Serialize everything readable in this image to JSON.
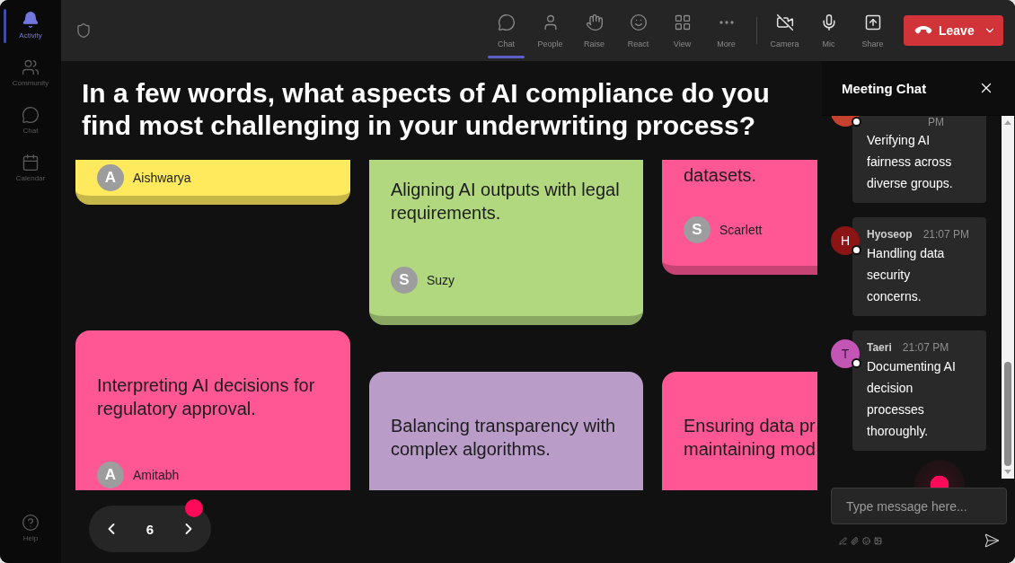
{
  "rail": {
    "items": [
      {
        "kind": "activity",
        "label": "Activity",
        "selected": true
      },
      {
        "kind": "community",
        "label": "Community",
        "selected": false
      },
      {
        "kind": "chat",
        "label": "Chat",
        "selected": false
      },
      {
        "kind": "calendar",
        "label": "Calendar",
        "selected": false
      }
    ],
    "help": "Help"
  },
  "toolbar": {
    "items": [
      {
        "kind": "chat",
        "label": "Chat",
        "selected": true
      },
      {
        "kind": "people",
        "label": "People",
        "selected": false
      },
      {
        "kind": "raise",
        "label": "Raise",
        "selected": false
      },
      {
        "kind": "react",
        "label": "React",
        "selected": false
      },
      {
        "kind": "view",
        "label": "View",
        "selected": false
      },
      {
        "kind": "more",
        "label": "More",
        "selected": false
      }
    ],
    "devices": [
      {
        "kind": "camera",
        "label": "Camera"
      },
      {
        "kind": "mic",
        "label": "Mic"
      },
      {
        "kind": "share",
        "label": "Share"
      }
    ],
    "leave": "Leave"
  },
  "question": "In a few words, what aspects of AI compliance do you find most challenging in your underwriting process?",
  "board": {
    "columns": [
      {
        "cards": [
          {
            "color": "#ffe95c",
            "author": "Aishwarya",
            "initial": "A"
          },
          {
            "color": "#ff5694",
            "text": "Interpreting AI decisions for regulatory approval.",
            "author": "Amitabh",
            "initial": "A"
          }
        ]
      },
      {
        "cards": [
          {
            "color": "#b1d87e",
            "text": "Aligning AI outputs with legal requirements.",
            "author": "Suzy",
            "initial": "S"
          },
          {
            "color": "#b99cc8",
            "text": "Balancing transparency with complex algorithms."
          }
        ]
      },
      {
        "cards": [
          {
            "color": "#ff5694",
            "text": "datasets.",
            "author": "Scarlett",
            "initial": "S"
          },
          {
            "color": "#ff5694",
            "text": "Ensuring data pr\nmaintaining mod"
          }
        ]
      }
    ]
  },
  "pager": {
    "page": "6"
  },
  "chat": {
    "title": "Meeting Chat",
    "messages": [
      {
        "color": "#c4412f",
        "time": "PM",
        "text": "Verifying AI fairness across diverse groups."
      },
      {
        "color": "#8b1414",
        "initial": "H",
        "name": "Hyoseop",
        "time": "21:07 PM",
        "text": "Handling data security concerns."
      },
      {
        "color": "#c355b5",
        "initial": "T",
        "name": "Taeri",
        "time": "21:07 PM",
        "text": "Documenting AI decision processes thoroughly."
      }
    ],
    "input": {
      "placeholder": "Type message here..."
    }
  }
}
